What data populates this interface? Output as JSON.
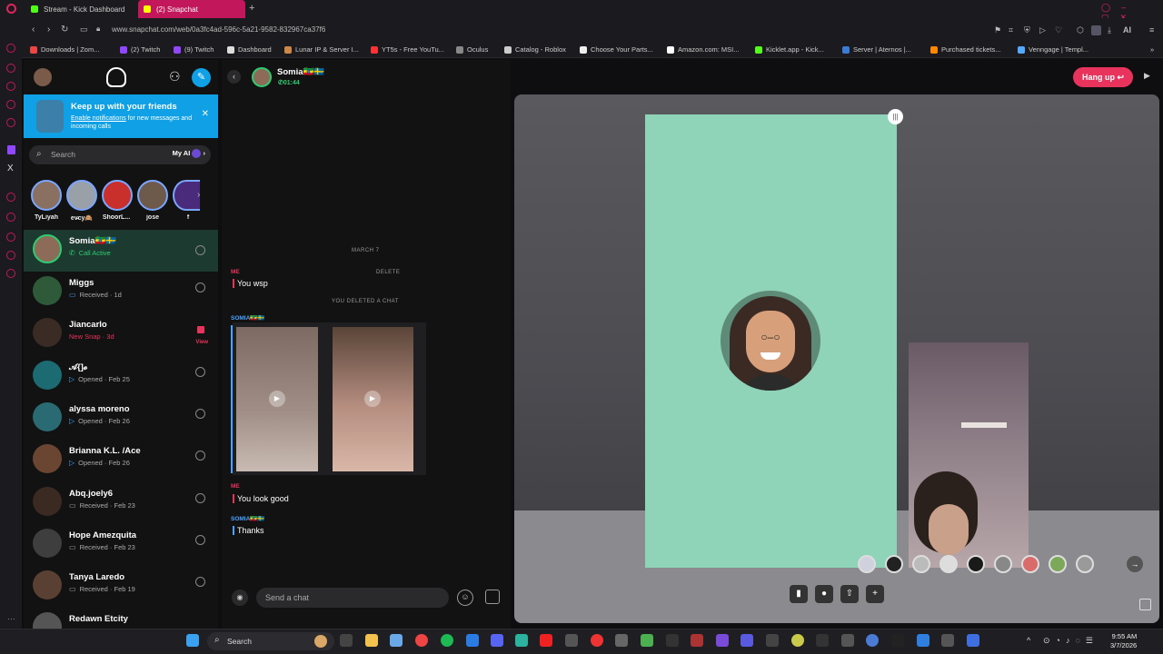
{
  "browser": {
    "tabs": [
      {
        "label": "Stream - Kick Dashboard",
        "active": false
      },
      {
        "label": "(2) Snapchat",
        "active": true
      }
    ],
    "url": "www.snapchat.com/web/0a3fc4ad-596c-5a21-9582-832967ca37f6",
    "bookmarks": [
      "Downloads | Zom...",
      "(2) Twitch",
      "(9) Twitch",
      "Dashboard",
      "Lunar IP & Server I...",
      "YT5s - Free YouTu...",
      "Oculus",
      "Catalog - Roblox",
      "Choose Your Parts...",
      "Amazon.com: MSI...",
      "Kicklet.app - Kick...",
      "Server | Aternos |...",
      "Purchased tickets...",
      "Venngage | Templ..."
    ],
    "toolbar_ai": "AI"
  },
  "sidebar": {
    "notification": {
      "title": "Keep up with your friends",
      "link": "Enable notifications",
      "body": " for new messages and incoming calls"
    },
    "search_placeholder": "Search",
    "my_ai": "My AI",
    "stories": [
      "TyLiyah",
      "ev̵cy🙈",
      "ShoorL...",
      "jose",
      "f"
    ],
    "friends": [
      {
        "name": "Somia🇪🇹🇸🇪",
        "status": "Call Active",
        "active": true
      },
      {
        "name": "Miggs",
        "status": "Received · 1d"
      },
      {
        "name": "Jiancarlo",
        "status": "New Snap · 3d",
        "extra": "View"
      },
      {
        "name": "𝒜{]𝓸",
        "status": "Opened · Feb 25"
      },
      {
        "name": "alyssa moreno",
        "status": "Opened · Feb 26"
      },
      {
        "name": "Brianna K.L. /Ace",
        "status": "Opened · Feb 26"
      },
      {
        "name": "Abq.joely6",
        "status": "Received · Feb 23"
      },
      {
        "name": "Hope Amezquita",
        "status": "Received · Feb 23"
      },
      {
        "name": "Tanya Laredo",
        "status": "Received · Feb 19"
      },
      {
        "name": "Redawn Etcity",
        "status": ""
      }
    ]
  },
  "chat": {
    "contact_name": "Somia🇪🇹🇸🇪",
    "call_time": "01:44",
    "date_divider": "MARCH 7",
    "me_label": "ME",
    "delete_label": "DELETE",
    "msg1": "You wsp",
    "deleted_notice": "YOU DELETED A CHAT",
    "them_label": "SOMIA🇪🇹🇸🇪",
    "me_label2": "ME",
    "msg2": "You look good",
    "them_label2": "SOMIA🇪🇹🇸🇪",
    "msg3": "Thanks",
    "input_placeholder": "Send a chat"
  },
  "call": {
    "hangup_label": "Hang up"
  },
  "taskbar": {
    "search_placeholder": "Search",
    "time": "9:55 AM",
    "date": "3/7/2026"
  },
  "colors": {
    "accent_pink": "#e8335d",
    "opera_red": "#c2185b",
    "snap_blue": "#0fa0e6",
    "remote_tile": "#8fd3b9",
    "call_active_green": "#2ecc71"
  }
}
